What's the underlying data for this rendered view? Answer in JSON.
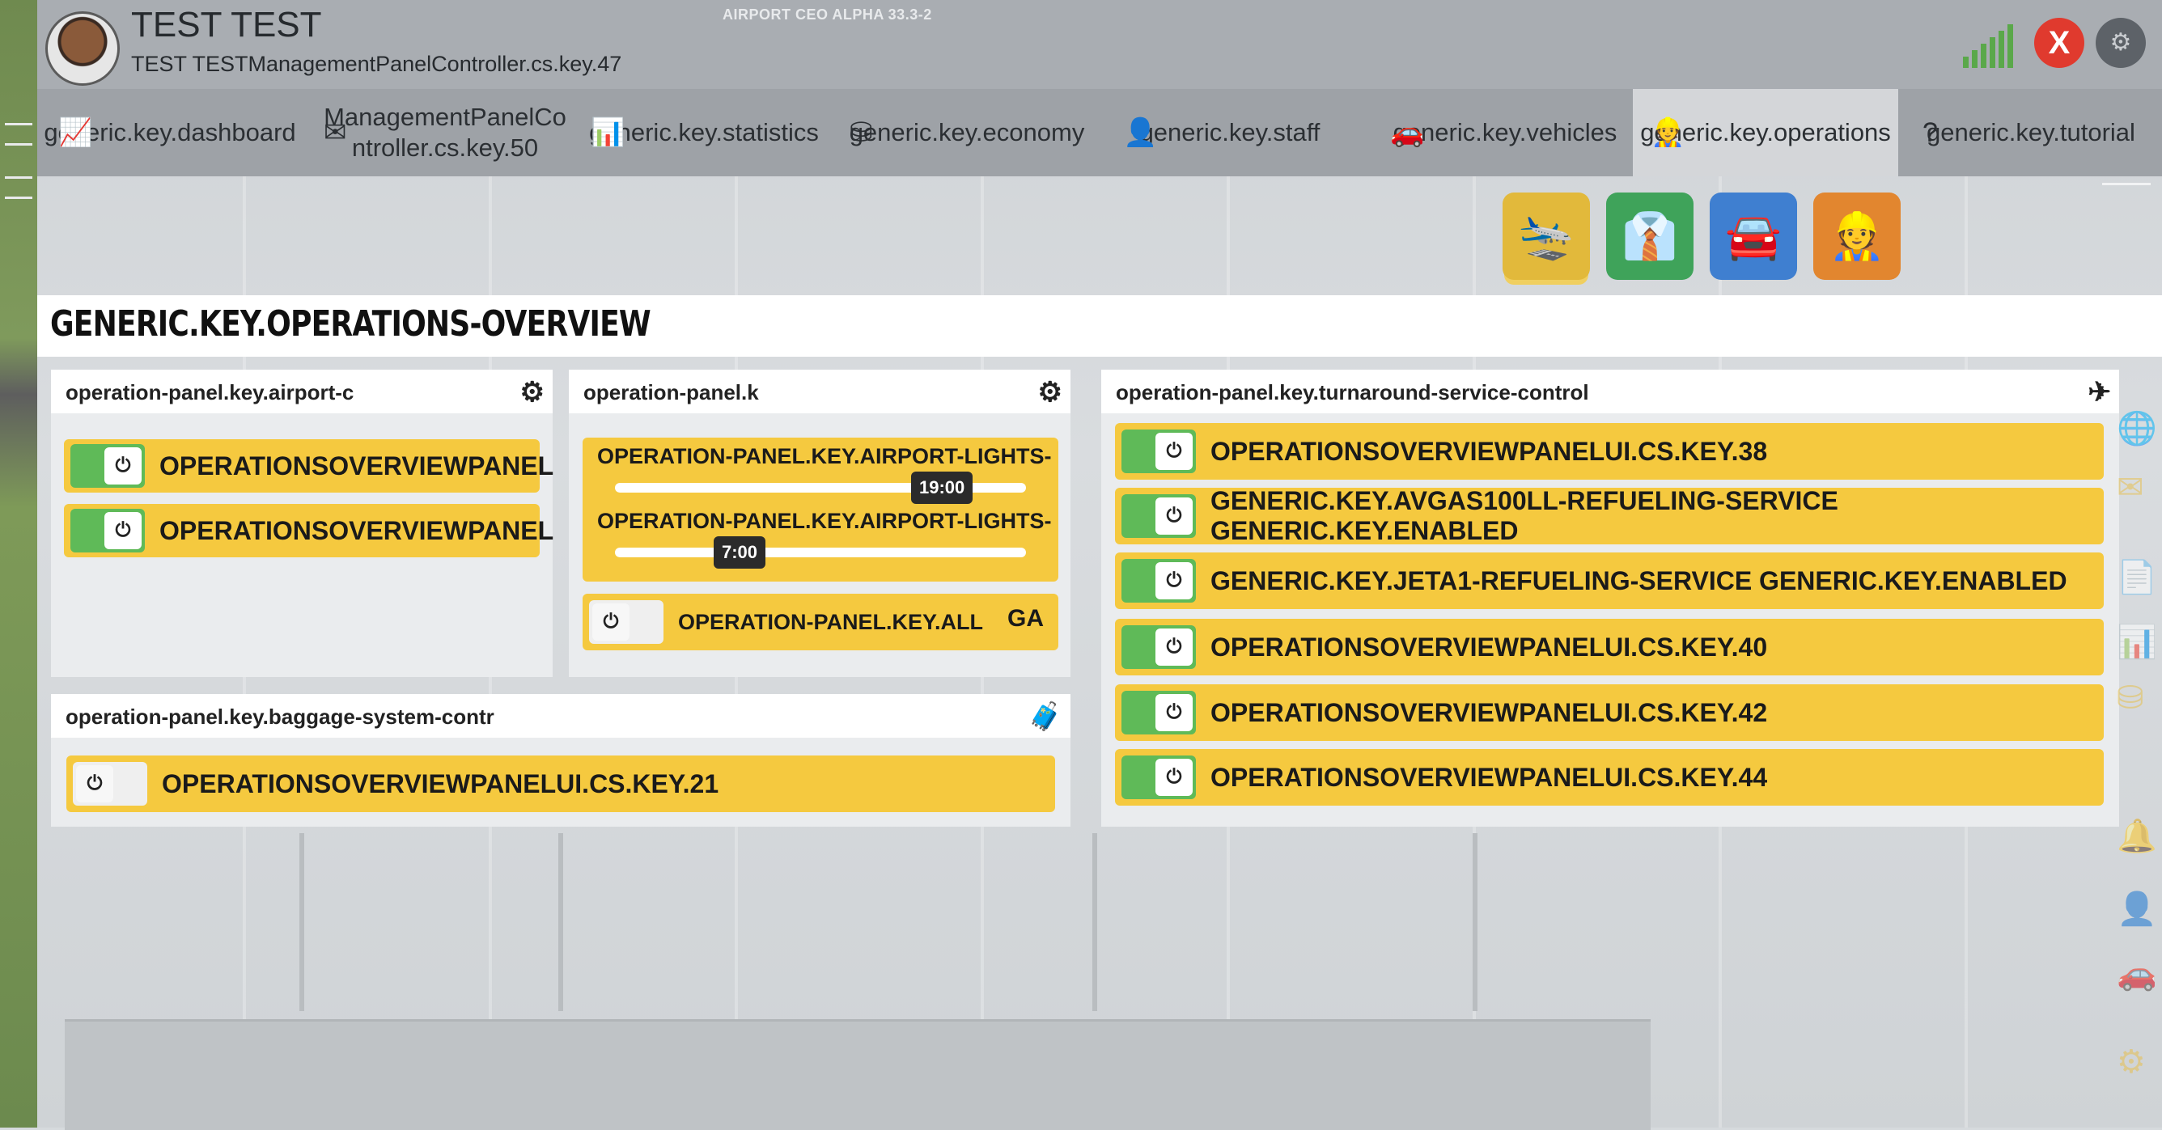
{
  "header": {
    "player_name": "TEST TEST",
    "player_subtitle": "TEST TESTManagementPanelController.cs.key.47",
    "version": "AIRPORT CEO ALPHA 33.3-2",
    "close_label": "X",
    "signal_icon": "signal-bars-icon",
    "settings_icon": "gear-icon"
  },
  "tabs": [
    {
      "label": "generic.key.dashboard",
      "icon": "chart-icon"
    },
    {
      "label": "ManagementPanelController.cs.key.50",
      "icon": "mail-icon"
    },
    {
      "label": "generic.key.statistics",
      "icon": "bar-chart-icon"
    },
    {
      "label": "generic.key.economy",
      "icon": "coins-icon"
    },
    {
      "label": "generic.key.staff",
      "icon": "person-icon"
    },
    {
      "label": "generic.key.vehicles",
      "icon": "car-icon"
    },
    {
      "label": "generic.key.operations",
      "icon": "worker-icon",
      "active": true
    },
    {
      "label": "generic.key.tutorial",
      "icon": "question-icon"
    }
  ],
  "subnav": [
    {
      "name": "airport-operations",
      "color": "#e2b93b",
      "active": true
    },
    {
      "name": "staff-operations",
      "color": "#3fa35a"
    },
    {
      "name": "vehicle-operations",
      "color": "#3f7fd0"
    },
    {
      "name": "contractor-operations",
      "color": "#e2862f"
    }
  ],
  "overview_title": "GENERIC.KEY.OPERATIONS-OVERVIEW",
  "panels": {
    "airport": {
      "title": "operation-panel.key.airport-c",
      "rows": [
        {
          "label": "OPERATIONSOVERVIEWPANEL",
          "enabled": true
        },
        {
          "label": "OPERATIONSOVERVIEWPANEL",
          "enabled": true
        }
      ]
    },
    "lights": {
      "title": "operation-panel.k",
      "sliders": [
        {
          "label": "OPERATION-PANEL.KEY.AIRPORT-LIGHTS-",
          "value": "19:00",
          "fraction": 0.8
        },
        {
          "label": "OPERATION-PANEL.KEY.AIRPORT-LIGHTS-",
          "value": "7:00",
          "fraction": 0.31
        }
      ],
      "all_row": {
        "label": "OPERATION-PANEL.KEY.ALL",
        "enabled": false,
        "badge": "GA"
      }
    },
    "baggage": {
      "title": "operation-panel.key.baggage-system-contr",
      "rows": [
        {
          "label": "OPERATIONSOVERVIEWPANELUI.CS.KEY.21",
          "enabled": false
        }
      ]
    },
    "turnaround": {
      "title": "operation-panel.key.turnaround-service-control",
      "rows": [
        {
          "label": "OPERATIONSOVERVIEWPANELUI.CS.KEY.38",
          "enabled": true
        },
        {
          "label": "GENERIC.KEY.AVGAS100LL-REFUELING-SERVICE GENERIC.KEY.ENABLED",
          "enabled": true
        },
        {
          "label": "GENERIC.KEY.JETA1-REFUELING-SERVICE GENERIC.KEY.ENABLED",
          "enabled": true
        },
        {
          "label": "OPERATIONSOVERVIEWPANELUI.CS.KEY.40",
          "enabled": true
        },
        {
          "label": "OPERATIONSOVERVIEWPANELUI.CS.KEY.42",
          "enabled": true
        },
        {
          "label": "OPERATIONSOVERVIEWPANELUI.CS.KEY.44",
          "enabled": true
        }
      ]
    }
  },
  "colors": {
    "row_yellow": "#f5c93f",
    "toggle_on": "#5fba58",
    "close_red": "#e03a2e"
  }
}
